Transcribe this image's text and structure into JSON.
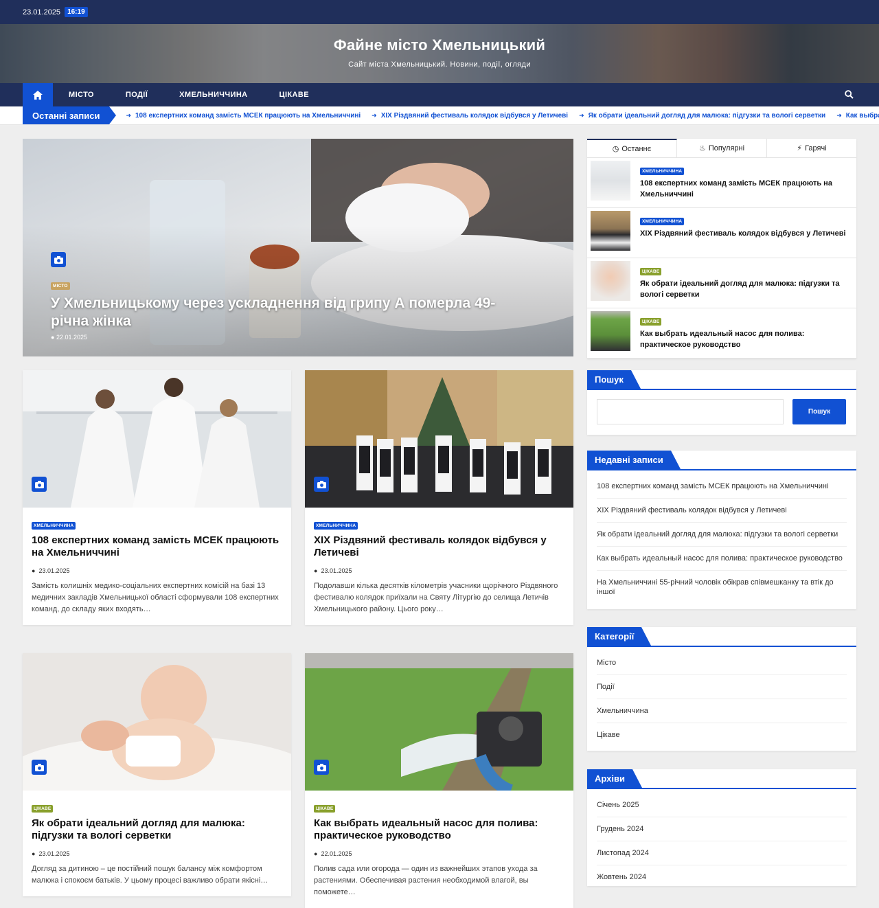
{
  "topbar": {
    "date": "23.01.2025",
    "time": "16:19"
  },
  "header": {
    "title": "Файне місто Хмельницький",
    "tagline": "Сайт міста Хмельницький. Новини, події, огляди"
  },
  "nav": {
    "items": [
      "МІСТО",
      "ПОДІЇ",
      "ХМЕЛЬНИЧЧИНА",
      "ЦІКАВЕ"
    ]
  },
  "ticker": {
    "label": "Останні записи",
    "items": [
      "108 експертних команд замість МСЕК працюють на Хмельниччині",
      "XIX Різдвяний фестиваль колядок відбувся у Летичеві",
      "Як обрати ідеальний догляд для малюка: підгузки та вологі серветки",
      "Как выбрать иде"
    ]
  },
  "hero": {
    "category": "МІСТО",
    "title": "У Хмельницькому через ускладнення від грипу А померла 49-річна жінка",
    "date": "22.01.2025"
  },
  "cards": [
    {
      "category": "ХМЕЛЬНИЧЧИНА",
      "title": "108 експертних команд замість МСЕК працюють на Хмельниччині",
      "date": "23.01.2025",
      "excerpt": "Замість колишніх медико-соціальних експертних комісій на базі 13 медичних закладів Хмельницької області сформували 108 експертних команд, до складу яких входять…"
    },
    {
      "category": "ХМЕЛЬНИЧЧИНА",
      "title": "XIX Різдвяний фестиваль колядок відбувся у Летичеві",
      "date": "23.01.2025",
      "excerpt": "Подолавши кілька десятків кілометрів учасники щорічного Різдвяного фестивалю колядок приїхали на Святу Літургію до селища Летичів Хмельницького району. Цього року…"
    },
    {
      "category": "ЦІКАВЕ",
      "title": "Як обрати ідеальний догляд для малюка: підгузки та вологі серветки",
      "date": "23.01.2025",
      "excerpt": "Догляд за дитиною – це постійний пошук балансу між комфортом малюка і спокоєм батьків. У цьому процесі важливо обрати якісні…"
    },
    {
      "category": "ЦІКАВЕ",
      "title": "Как выбрать идеальный насос для полива: практическое руководство",
      "date": "22.01.2025",
      "excerpt": "Полив сада или огорода — один из важнейших этапов ухода за растениями. Обеспечивая растения необходимой влагой, вы поможете…"
    }
  ],
  "tabs": {
    "labels": [
      "Останнє",
      "Популярні",
      "Гарячі"
    ],
    "posts": [
      {
        "category": "ХМЕЛЬНИЧЧИНА",
        "title": "108 експертних команд замість МСЕК працюють на Хмельниччині"
      },
      {
        "category": "ХМЕЛЬНИЧЧИНА",
        "title": "XIX Різдвяний фестиваль колядок відбувся у Летичеві"
      },
      {
        "category": "ЦІКАВЕ",
        "title": "Як обрати ідеальний догляд для малюка: підгузки та вологі серветки"
      },
      {
        "category": "ЦІКАВЕ",
        "title": "Как выбрать идеальный насос для полива: практическое руководство"
      }
    ]
  },
  "search_widget": {
    "title": "Пошук",
    "button": "Пошук"
  },
  "recent": {
    "title": "Недавні записи",
    "items": [
      "108 експертних команд замість МСЕК працюють на Хмельниччині",
      "XIX Різдвяний фестиваль колядок відбувся у Летичеві",
      "Як обрати ідеальний догляд для малюка: підгузки та вологі серветки",
      "Как выбрать идеальный насос для полива: практическое руководство",
      "На Хмельниччині 55-річний чоловік обікрав співмешканку та втік до іншої"
    ]
  },
  "categories": {
    "title": "Категорії",
    "items": [
      "Місто",
      "Події",
      "Хмельниччина",
      "Цікаве"
    ]
  },
  "archives": {
    "title": "Архіви",
    "items": [
      "Січень 2025",
      "Грудень 2024",
      "Листопад 2024",
      "Жовтень 2024"
    ]
  },
  "colors": {
    "navy": "#202f5b",
    "accent": "#1151d3",
    "olive": "#89a02c"
  },
  "icons": [
    "home-icon",
    "search-icon",
    "camera-icon",
    "clock-icon",
    "fire-icon",
    "bolt-icon",
    "arrow-icon"
  ]
}
